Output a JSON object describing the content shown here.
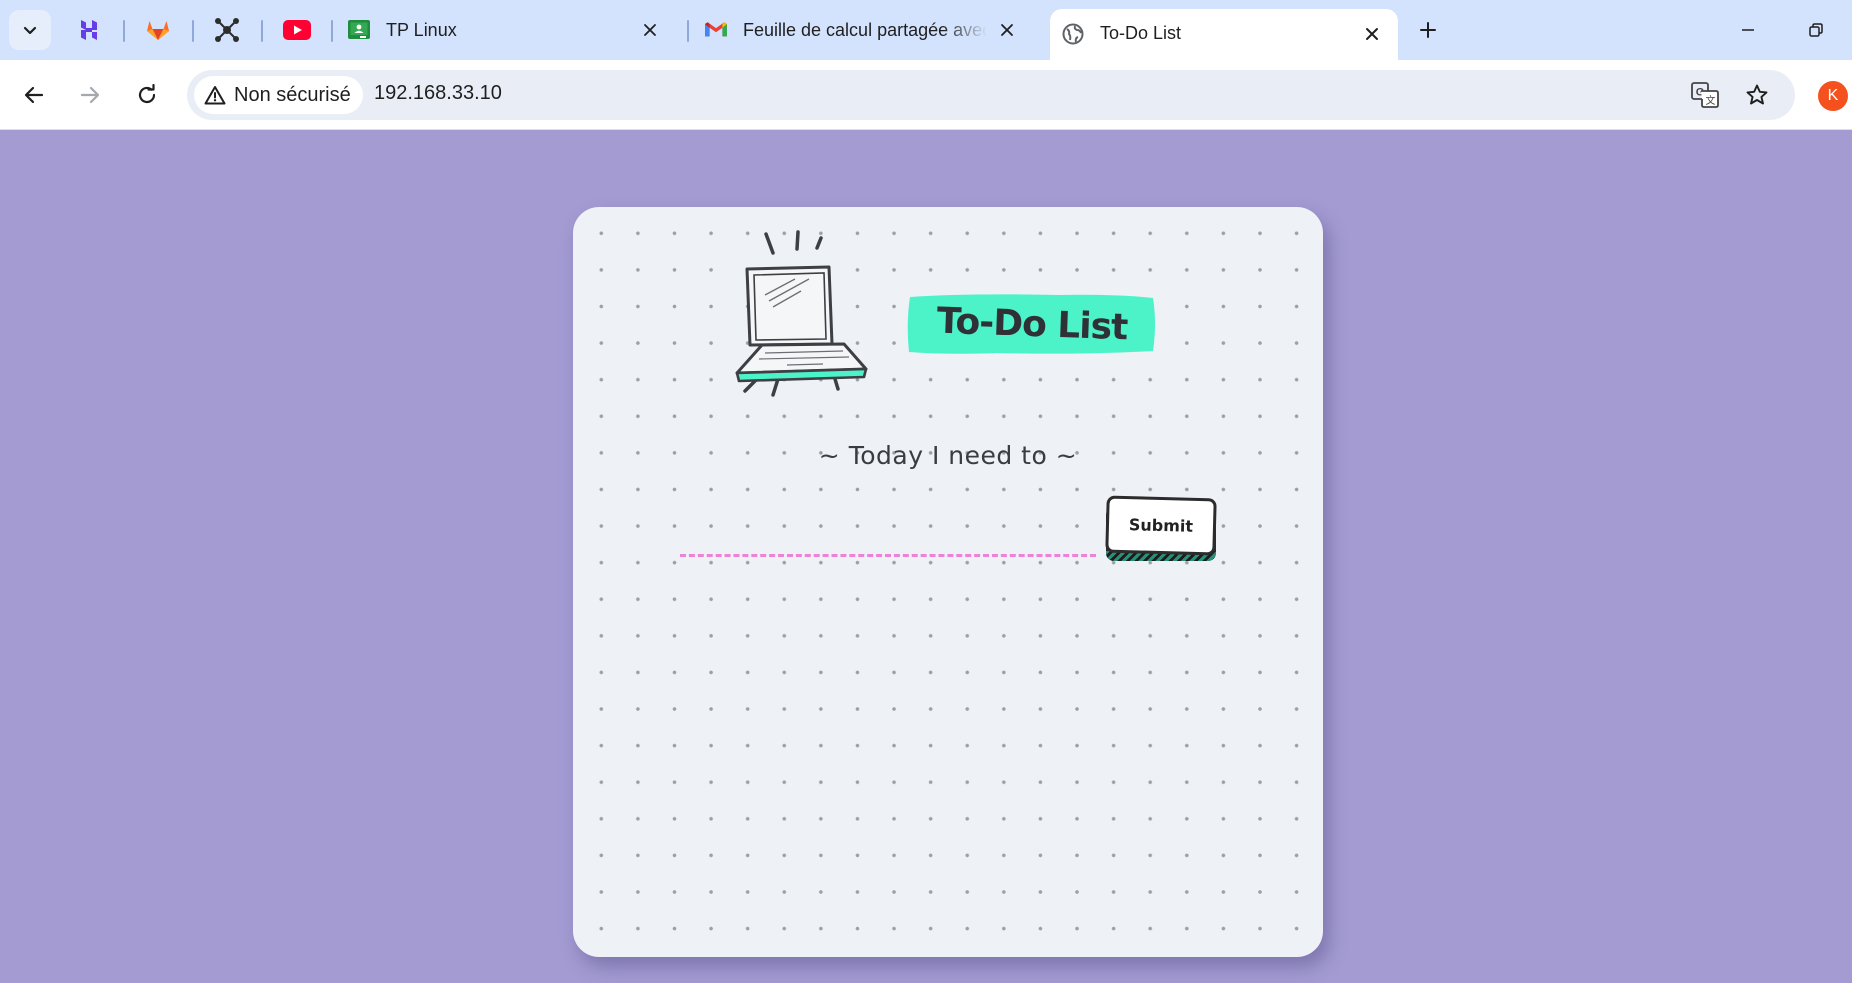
{
  "browser": {
    "tabs": [
      {
        "title": "TP Linux",
        "icon": "google-classroom-icon"
      },
      {
        "title": "Feuille de calcul partagée avec vous",
        "icon": "gmail-icon"
      },
      {
        "title": "To-Do List",
        "icon": "globe-icon",
        "active": true
      }
    ],
    "pinned_tabs": [
      {
        "icon": "hostinger-icon"
      },
      {
        "icon": "gitlab-icon"
      },
      {
        "icon": "network-graph-icon"
      },
      {
        "icon": "youtube-icon"
      }
    ],
    "address_bar": {
      "security_label": "Non sécurisé",
      "url": "192.168.33.10"
    },
    "profile_initial": "K",
    "colors": {
      "tab_strip": "#d3e3fd",
      "profile": "#f4511e"
    }
  },
  "page": {
    "title": "To-Do List",
    "subtitle": "~ Today I need to ~",
    "input": {
      "value": "",
      "placeholder": ""
    },
    "submit_label": "Submit",
    "colors": {
      "background": "#a39bd2",
      "card": "#eef1f6",
      "accent": "#4cf2c8",
      "input_underline": "#ee82d9"
    }
  }
}
